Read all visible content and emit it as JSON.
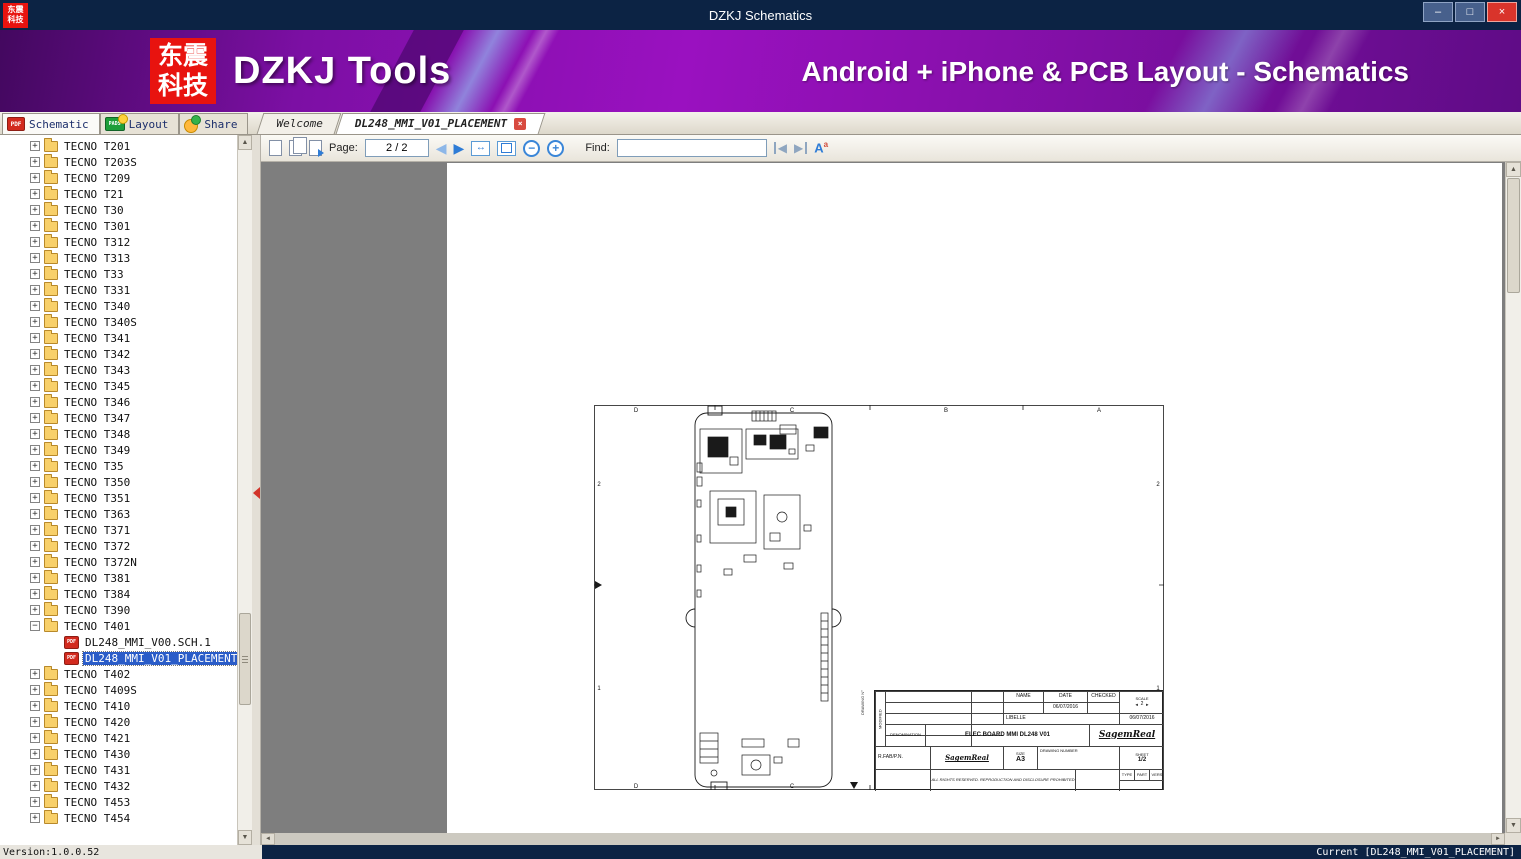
{
  "window": {
    "title": "DZKJ Schematics"
  },
  "banner": {
    "logo_line1": "东震",
    "logo_line2": "科技",
    "app_name": "DZKJ Tools",
    "tagline": "Android + iPhone & PCB Layout - Schematics"
  },
  "main_tabs": {
    "schematic": "Schematic",
    "layout": "Layout",
    "share": "Share"
  },
  "doc_tabs": {
    "welcome": "Welcome",
    "active": "DL248_MMI_V01_PLACEMENT"
  },
  "toolbar": {
    "page_label": "Page:",
    "page_value": "2 / 2",
    "find_label": "Find:",
    "find_value": ""
  },
  "icons": {
    "minimize": "–",
    "maximize": "□",
    "close": "×",
    "prev_page": "◀",
    "next_page": "▶",
    "zoom_out": "−",
    "zoom_in": "+",
    "fit_width": "↔",
    "find_prev": "◀",
    "find_next": "▶",
    "match_case_main": "A",
    "match_case_sup": "a",
    "up_arrow": "▲",
    "down_arrow": "▼",
    "left_arrow": "◄",
    "right_arrow": "►",
    "tab_close": "×",
    "pdf_badge": "PDF",
    "pads_badge": "PADS",
    "expand": "+",
    "collapse": "−"
  },
  "tree": {
    "items": [
      {
        "t": "folder",
        "label": "TECNO T201"
      },
      {
        "t": "folder",
        "label": "TECNO T203S"
      },
      {
        "t": "folder",
        "label": "TECNO T209"
      },
      {
        "t": "folder",
        "label": "TECNO T21"
      },
      {
        "t": "folder",
        "label": "TECNO T30"
      },
      {
        "t": "folder",
        "label": "TECNO T301"
      },
      {
        "t": "folder",
        "label": "TECNO T312"
      },
      {
        "t": "folder",
        "label": "TECNO T313"
      },
      {
        "t": "folder",
        "label": "TECNO T33"
      },
      {
        "t": "folder",
        "label": "TECNO T331"
      },
      {
        "t": "folder",
        "label": "TECNO T340"
      },
      {
        "t": "folder",
        "label": "TECNO T340S"
      },
      {
        "t": "folder",
        "label": "TECNO T341"
      },
      {
        "t": "folder",
        "label": "TECNO T342"
      },
      {
        "t": "folder",
        "label": "TECNO T343"
      },
      {
        "t": "folder",
        "label": "TECNO T345"
      },
      {
        "t": "folder",
        "label": "TECNO T346"
      },
      {
        "t": "folder",
        "label": "TECNO T347"
      },
      {
        "t": "folder",
        "label": "TECNO T348"
      },
      {
        "t": "folder",
        "label": "TECNO T349"
      },
      {
        "t": "folder",
        "label": "TECNO T35"
      },
      {
        "t": "folder",
        "label": "TECNO T350"
      },
      {
        "t": "folder",
        "label": "TECNO T351"
      },
      {
        "t": "folder",
        "label": "TECNO T363"
      },
      {
        "t": "folder",
        "label": "TECNO T371"
      },
      {
        "t": "folder",
        "label": "TECNO T372"
      },
      {
        "t": "folder",
        "label": "TECNO T372N"
      },
      {
        "t": "folder",
        "label": "TECNO T381"
      },
      {
        "t": "folder",
        "label": "TECNO T384"
      },
      {
        "t": "folder",
        "label": "TECNO T390"
      },
      {
        "t": "folder",
        "label": "TECNO T401",
        "expanded": true
      },
      {
        "t": "pdf",
        "label": "DL248_MMI_V00.SCH.1"
      },
      {
        "t": "pdf",
        "label": "DL248_MMI_V01_PLACEMENT",
        "selected": true
      },
      {
        "t": "folder",
        "label": "TECNO T402"
      },
      {
        "t": "folder",
        "label": "TECNO T409S"
      },
      {
        "t": "folder",
        "label": "TECNO T410"
      },
      {
        "t": "folder",
        "label": "TECNO T420"
      },
      {
        "t": "folder",
        "label": "TECNO T421"
      },
      {
        "t": "folder",
        "label": "TECNO T430"
      },
      {
        "t": "folder",
        "label": "TECNO T431"
      },
      {
        "t": "folder",
        "label": "TECNO T432"
      },
      {
        "t": "folder",
        "label": "TECNO T453"
      },
      {
        "t": "folder",
        "label": "TECNO T454"
      }
    ]
  },
  "drawing": {
    "grid_letters": [
      "D",
      "C",
      "B",
      "A"
    ],
    "grid_numbers": [
      "2",
      "1"
    ],
    "vertical_label": "DRAWING N°",
    "titleblock": {
      "modified": "MODIFIED",
      "name": "NAME",
      "date": "DATE",
      "checked": "CHECKED",
      "date_value_1": "06/07/2016",
      "date_value_2": "06/07/2016",
      "libelle": "LIBELLE",
      "denomination": "DENOMINATION",
      "denomination_value": "ELEC BOARD MMI DL248 V01",
      "sheet": "SHEET",
      "sheet_value": "1/2",
      "rfab": "R.FAB/P.N.",
      "brand": "SagemReal",
      "size": "SIZE",
      "size_value": "A3",
      "drawing_number": "DRAWING NUMBER",
      "type": "TYPE",
      "part": "PART",
      "vers": "VERS",
      "scale": "SCALE",
      "scale_value": "2",
      "note": "ALL RIGHTS RESERVED. REPRODUCTION AND DISCLOSURE PROHIBITED"
    }
  },
  "statusbar": {
    "version": "Version:1.0.0.52",
    "current": "Current [DL248_MMI_V01_PLACEMENT]"
  }
}
